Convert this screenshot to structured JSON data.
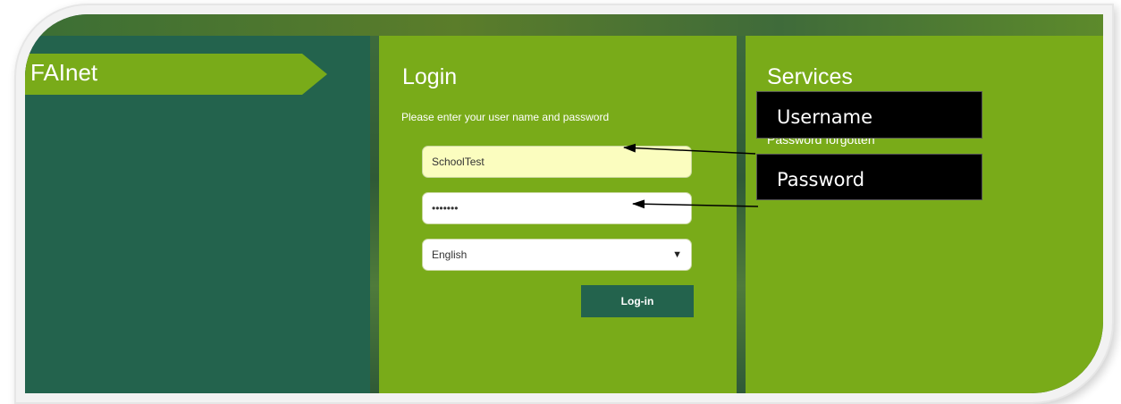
{
  "brand": {
    "name": "FAInet"
  },
  "login": {
    "title": "Login",
    "instruction": "Please enter your user name and password",
    "username_value": "SchoolTest",
    "password_value": "•••••••",
    "language_selected": "English",
    "submit_label": "Log-in"
  },
  "services": {
    "title": "Services",
    "password_forgotten": "Password forgotten"
  },
  "annotations": {
    "username_label": "Username",
    "password_label": "Password"
  },
  "icons": {
    "dropdown": "▼"
  },
  "colors": {
    "dark_green": "#23634d",
    "lime_green": "#79ab19",
    "username_highlight": "#fbfdbf"
  }
}
